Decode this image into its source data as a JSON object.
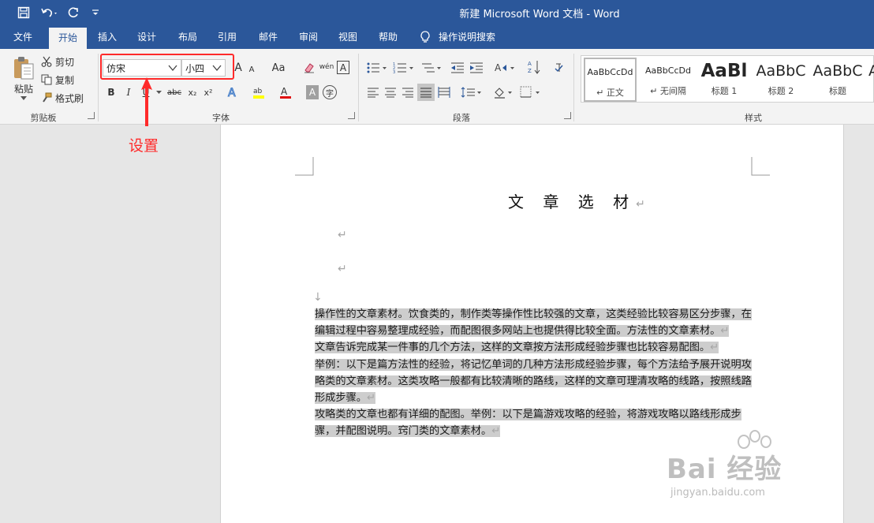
{
  "titlebar": {
    "title": "新建 Microsoft Word 文档  -  Word",
    "quick_access": [
      "save-icon",
      "undo-icon",
      "redo-icon",
      "customize-icon"
    ]
  },
  "tabs": [
    "文件",
    "开始",
    "插入",
    "设计",
    "布局",
    "引用",
    "邮件",
    "审阅",
    "视图",
    "帮助"
  ],
  "active_tab": "开始",
  "tell_me": "操作说明搜索",
  "clipboard": {
    "paste": "粘贴",
    "cut": "剪切",
    "copy": "复制",
    "format_painter": "格式刷",
    "label": "剪贴板"
  },
  "font": {
    "name": "仿宋",
    "size": "小四",
    "label": "字体",
    "bold": "B",
    "italic": "I",
    "underline": "U",
    "strike": "abc",
    "subscript": "x₂",
    "superscript": "x²",
    "grow": "A",
    "shrink": "A",
    "change_case": "Aa",
    "phonetic": "wén",
    "char_border": "A",
    "char_shading": "A",
    "enclose": "字"
  },
  "paragraph": {
    "label": "段落"
  },
  "styles": {
    "label": "样式",
    "items": [
      {
        "sample": "AaBbCcDd",
        "name": "正文",
        "prefix": "↵"
      },
      {
        "sample": "AaBbCcDd",
        "name": "无间隔",
        "prefix": "↵"
      },
      {
        "sample": "AaBl",
        "name": "标题 1",
        "prefix": ""
      },
      {
        "sample": "AaBbC",
        "name": "标题 2",
        "prefix": ""
      },
      {
        "sample": "AaBbC",
        "name": "标题",
        "prefix": ""
      }
    ],
    "last_partial": "A"
  },
  "annotation": {
    "label": "设置",
    "color": "#ff2a2a"
  },
  "document": {
    "title": "文 章 选 材",
    "paragraph_mark": "↵",
    "line_break": "↓",
    "paragraphs": [
      "操作性的文章素材。饮食类的，制作类等操作性比较强的文章，这类经验比较容易区分步骤，在编辑过程中容易整理成经验，而配图很多网站上也提供得比较全面。方法性的文章素材。",
      "文章告诉完成某一件事的几个方法，这样的文章按方法形成经验步骤也比较容易配图。",
      "举例：以下是篇方法性的经验，将记忆单词的几种方法形成经验步骤，每个方法给予展开说明攻略类的文章素材。这类攻略一般都有比较清晰的路线，这样的文章可理清攻略的线路，按照线路形成步骤。",
      "攻略类的文章也都有详细的配图。举例：以下是篇游戏攻略的经验，将游戏攻略以路线形成步骤，并配图说明。窍门类的文章素材。"
    ]
  },
  "watermark": {
    "brand": "Bai  经验",
    "url": "jingyan.baidu.com"
  },
  "colors": {
    "accent": "#2b579a",
    "ribbon_bg": "#f3f3f3",
    "selection": "#cdcdcd"
  }
}
